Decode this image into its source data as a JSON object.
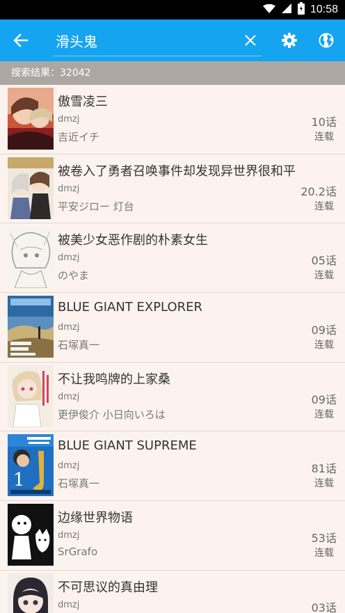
{
  "status_bar": {
    "time": "10:58"
  },
  "toolbar": {
    "search_value": "滑头鬼",
    "accent": "#15a4f0"
  },
  "results": {
    "label": "搜索结果：32042"
  },
  "items": [
    {
      "title": "傲雪凌三",
      "source": "dmzj",
      "author": "吉近イチ",
      "chapters": "10话",
      "status": "连载"
    },
    {
      "title": "被卷入了勇者召唤事件却发现异世界很和平",
      "source": "dmzj",
      "author": "平安ジロー 灯台",
      "chapters": "20.2话",
      "status": "连载"
    },
    {
      "title": "被美少女恶作剧的朴素女生",
      "source": "dmzj",
      "author": "のやま",
      "chapters": "05话",
      "status": "连载"
    },
    {
      "title": "BLUE GIANT EXPLORER",
      "source": "dmzj",
      "author": "石塚真一",
      "chapters": "09话",
      "status": "连载"
    },
    {
      "title": "不让我鸣牌的上家桑",
      "source": "dmzj",
      "author": "更伊俊介 小日向いろは",
      "chapters": "09话",
      "status": "连载"
    },
    {
      "title": "BLUE GIANT SUPREME",
      "source": "dmzj",
      "author": "石塚真一",
      "chapters": "81话",
      "status": "连载"
    },
    {
      "title": "边缘世界物语",
      "source": "dmzj",
      "author": "SrGrafo",
      "chapters": "53话",
      "status": "连载"
    },
    {
      "title": "不可思议的真由理",
      "source": "dmzj",
      "author": "",
      "chapters": "03话",
      "status": ""
    }
  ]
}
